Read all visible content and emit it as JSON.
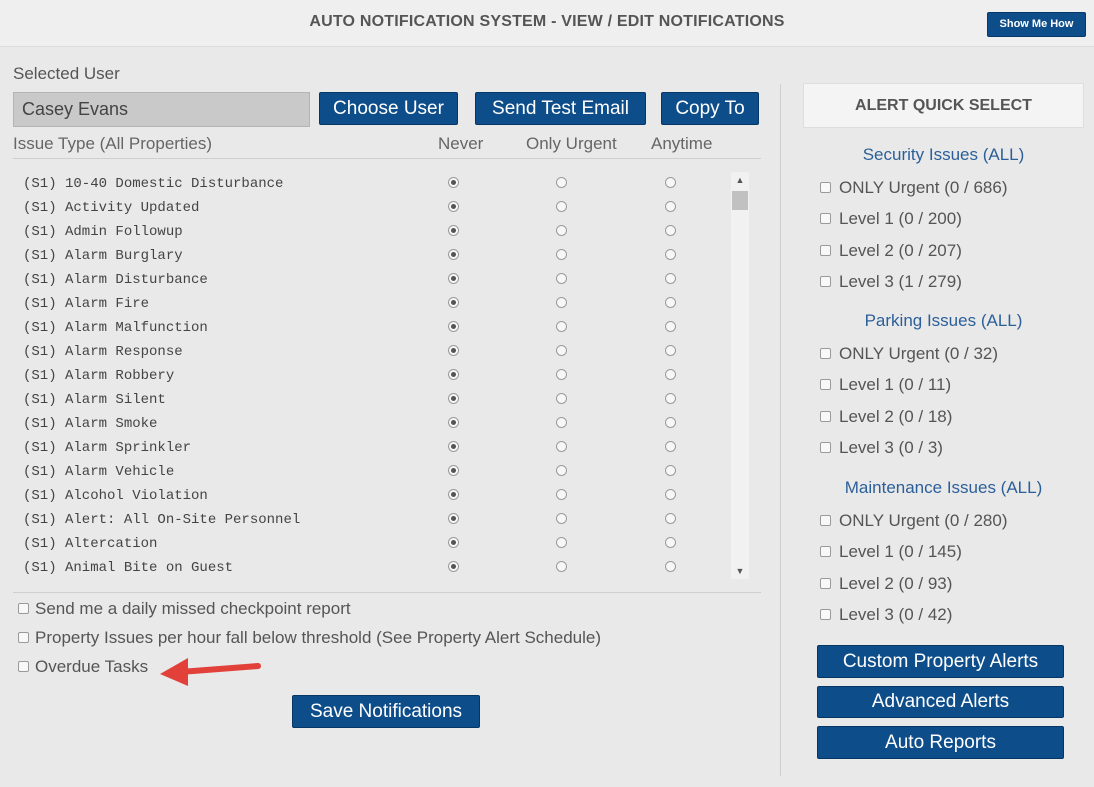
{
  "header": {
    "title": "AUTO NOTIFICATION SYSTEM - VIEW / EDIT NOTIFICATIONS",
    "show_me_how": "Show Me How"
  },
  "user": {
    "label": "Selected User",
    "value": "Casey Evans",
    "choose_button": "Choose User",
    "test_email_button": "Send Test Email",
    "copy_button": "Copy To"
  },
  "table": {
    "header_issue": "Issue Type (All Properties)",
    "header_never": "Never",
    "header_urgent": "Only Urgent",
    "header_anytime": "Anytime",
    "rows": [
      {
        "name": "(S1) 10-40 Domestic Disturbance",
        "selected": "never"
      },
      {
        "name": "(S1) Activity Updated",
        "selected": "never"
      },
      {
        "name": "(S1) Admin Followup",
        "selected": "never"
      },
      {
        "name": "(S1) Alarm Burglary",
        "selected": "never"
      },
      {
        "name": "(S1) Alarm Disturbance",
        "selected": "never"
      },
      {
        "name": "(S1) Alarm Fire",
        "selected": "never"
      },
      {
        "name": "(S1) Alarm Malfunction",
        "selected": "never"
      },
      {
        "name": "(S1) Alarm Response",
        "selected": "never"
      },
      {
        "name": "(S1) Alarm Robbery",
        "selected": "never"
      },
      {
        "name": "(S1) Alarm Silent",
        "selected": "never"
      },
      {
        "name": "(S1) Alarm Smoke",
        "selected": "never"
      },
      {
        "name": "(S1) Alarm Sprinkler",
        "selected": "never"
      },
      {
        "name": "(S1) Alarm Vehicle",
        "selected": "never"
      },
      {
        "name": "(S1) Alcohol Violation",
        "selected": "never"
      },
      {
        "name": "(S1) Alert: All On-Site Personnel",
        "selected": "never"
      },
      {
        "name": "(S1) Altercation",
        "selected": "never"
      },
      {
        "name": "(S1) Animal Bite on Guest",
        "selected": "never"
      }
    ]
  },
  "options": {
    "daily_missed": "Send me a daily missed checkpoint report",
    "property_threshold": "Property Issues per hour fall below threshold (See Property Alert Schedule)",
    "overdue_tasks": "Overdue Tasks",
    "save_button": "Save Notifications"
  },
  "quick_select": {
    "title": "ALERT QUICK SELECT",
    "groups": [
      {
        "title": "Security Issues (ALL)",
        "items": [
          "ONLY Urgent (0 / 686)",
          "Level 1 (0 / 200)",
          "Level 2 (0 / 207)",
          "Level 3 (1 / 279)"
        ]
      },
      {
        "title": "Parking Issues (ALL)",
        "items": [
          "ONLY Urgent (0 / 32)",
          "Level 1 (0 / 11)",
          "Level 2 (0 / 18)",
          "Level 3 (0 / 3)"
        ]
      },
      {
        "title": "Maintenance Issues (ALL)",
        "items": [
          "ONLY Urgent (0 / 280)",
          "Level 1 (0 / 145)",
          "Level 2 (0 / 93)",
          "Level 3 (0 / 42)"
        ]
      }
    ],
    "custom_button": "Custom Property Alerts",
    "advanced_button": "Advanced Alerts",
    "reports_button": "Auto Reports"
  },
  "colors": {
    "button": "#0d4d8a",
    "group_title": "#2c5f99",
    "annotation_arrow": "#e2413a"
  }
}
